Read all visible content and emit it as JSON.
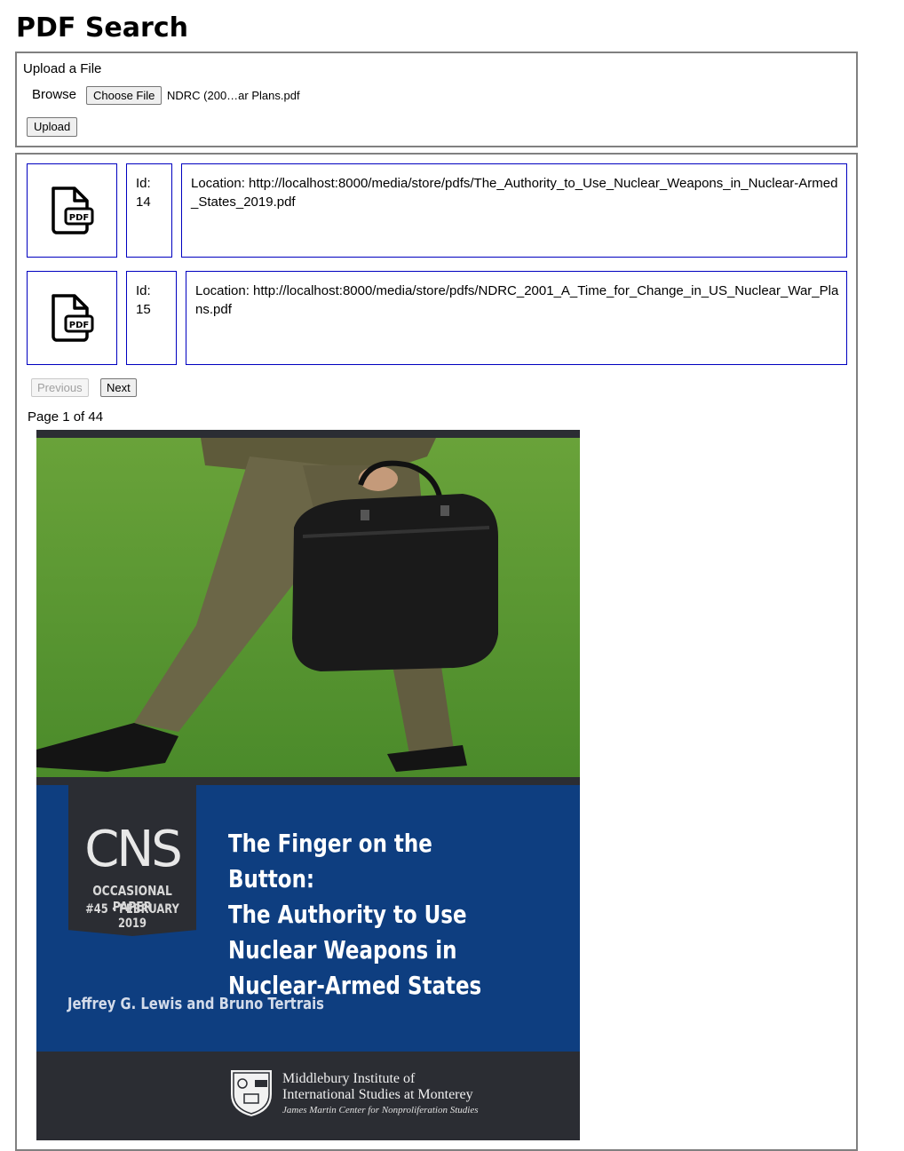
{
  "page_title": "PDF Search",
  "upload": {
    "heading": "Upload a File",
    "browse_label": "Browse",
    "choose_file_label": "Choose File",
    "selected_file": "NDRC (200…ar Plans.pdf",
    "upload_label": "Upload"
  },
  "results": [
    {
      "icon": "pdf-file-icon",
      "id_label": "Id:",
      "id": "14",
      "location": "Location: http://localhost:8000/media/store/pdfs/The_Authority_to_Use_Nuclear_Weapons_in_Nuclear-Armed_States_2019.pdf"
    },
    {
      "icon": "pdf-file-icon",
      "id_label": "Id:",
      "id": "15",
      "location": "Location: http://localhost:8000/media/store/pdfs/NDRC_2001_A_Time_for_Change_in_US_Nuclear_War_Plans.pdf"
    }
  ],
  "pagination": {
    "previous_label": "Previous",
    "previous_disabled": true,
    "next_label": "Next",
    "page_indicator": "Page 1 of 44"
  },
  "preview": {
    "cns_logo": "CNS",
    "series": "OCCASIONAL PAPER",
    "issue": "#45 · FEBRUARY 2019",
    "title_lines": [
      "The Finger on the Button:",
      "The Authority to Use",
      "Nuclear Weapons in",
      "Nuclear-Armed States"
    ],
    "authors": "Jeffrey G. Lewis and Bruno Tertrais",
    "institute_line1": "Middlebury Institute of",
    "institute_line2": "International Studies at Monterey",
    "institute_line3": "James Martin Center for Nonproliferation Studies"
  },
  "colors": {
    "cell_border": "#0000c0",
    "cover_blue": "#0e3e80",
    "cover_dark": "#2b2d33"
  }
}
